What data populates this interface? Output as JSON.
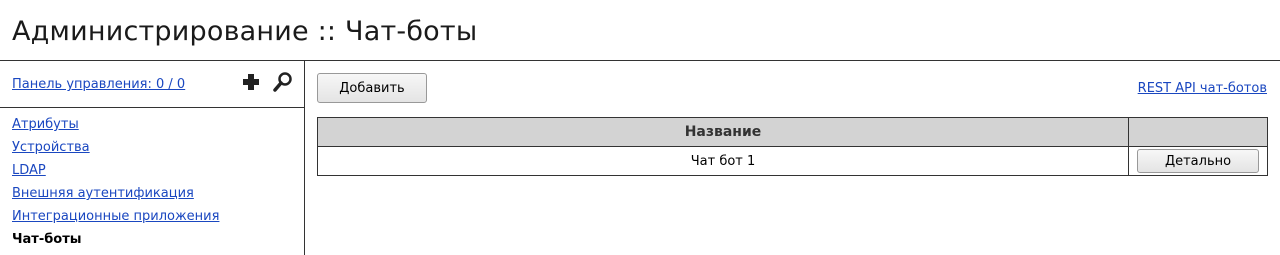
{
  "page": {
    "title": "Администрирование :: Чат-боты"
  },
  "sidebar": {
    "dashboard_link": "Панель управления: 0 / 0",
    "icons": {
      "add": "plus-icon",
      "search": "search-icon"
    },
    "items": [
      {
        "label": "Атрибуты",
        "active": false
      },
      {
        "label": "Устройства",
        "active": false
      },
      {
        "label": "LDAP",
        "active": false
      },
      {
        "label": "Внешняя аутентификация",
        "active": false
      },
      {
        "label": "Интеграционные приложения",
        "active": false
      },
      {
        "label": "Чат-боты",
        "active": true
      }
    ]
  },
  "main": {
    "add_button": "Добавить",
    "api_link": "REST API чат-ботов",
    "table": {
      "columns": [
        "Название",
        ""
      ],
      "rows": [
        {
          "name": "Чат бот 1",
          "action": "Детально"
        }
      ]
    }
  },
  "colors": {
    "link": "#1a47c0",
    "header_bg": "#d3d3d3"
  }
}
